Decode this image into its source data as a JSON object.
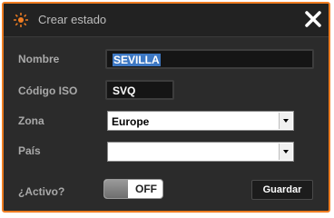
{
  "dialog": {
    "title": "Crear estado",
    "accent_color": "#ef7d22",
    "title_icon": "sun-icon",
    "close_icon": "close-icon"
  },
  "form": {
    "nombre": {
      "label": "Nombre",
      "value": "SEVILLA"
    },
    "codigo_iso": {
      "label": "Código ISO",
      "value": "SVQ"
    },
    "zona": {
      "label": "Zona",
      "value": "Europe"
    },
    "pais": {
      "label": "País",
      "value": ""
    },
    "activo": {
      "label": "¿Activo?",
      "state": "OFF"
    }
  },
  "actions": {
    "save_label": "Guardar"
  }
}
